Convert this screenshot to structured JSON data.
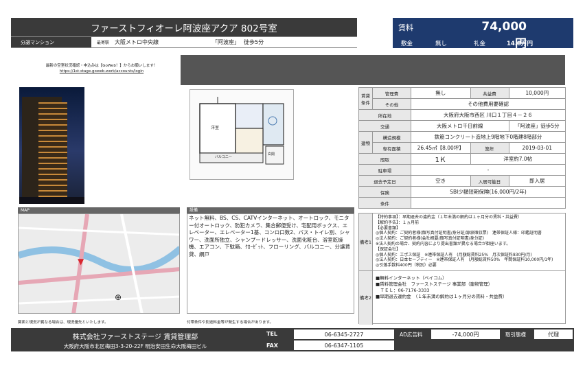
{
  "header": {
    "title": "ファーストフィオーレ阿波座アクア 802号室",
    "category": "分譲マンション",
    "station_label": "最寄駅",
    "line": "大阪メトロ中央線",
    "station": "「阿波座」",
    "walk": "徒歩5分"
  },
  "rent": {
    "label": "賃料",
    "value": "74,000円",
    "deposit_label": "敷金",
    "deposit": "無し",
    "key_label": "礼金",
    "key": "14.8万円"
  },
  "notice": {
    "line1": "最新の空室状況確認・申込みは【GoWeb！】からお願いします！",
    "url": "https://1st-stage.goweb.work/accounts/login"
  },
  "floorplan": {
    "balcony": "バルコニー",
    "room": "洋室",
    "entrance": "玄関"
  },
  "map": {
    "title": "MAP"
  },
  "settings": {
    "title": "設備",
    "text": "ネット無料、BS、CS、CATVインターネット、オートロック、モニター付オートロック、防犯カメラ、集合郵便受け、宅配用ボックス、エレベーター、エレベーター1基、コンロ口数2、バス・トイレ別、シャワー、洗面所独立、シャンプードレッサー、洗面化粧台、浴室乾燥機、エアコン、下駄箱、ｸﾛｰｾﾞｯﾄ、フローリング、バルコニー、分譲賃貸、網戸"
  },
  "footnotes": {
    "left": "図面と現況が異なる場合は、現況優先といたします。",
    "right": "付帯条件や別途料金等が発生する場合があります。"
  },
  "props": {
    "h_cond": "賃貸条件",
    "mgmt_label": "管理費",
    "mgmt": "無し",
    "common_label": "共益費",
    "common": "10,000円",
    "other_label": "その他",
    "other": "その他費用要確認",
    "loc_label": "所在地",
    "loc": "大阪府大阪市西区 川口１丁目４－２６",
    "traffic_label": "交通",
    "line": "大阪メトロ千日前線",
    "station": "「阿波座」徒歩5分",
    "h_bld": "建物",
    "struct_label": "構造規模",
    "struct": "鉄筋コンクリート造地上9階地下0階建8階部分",
    "area_label": "専有面積",
    "area": "26.45㎡【8.00坪】",
    "built_label": "築年",
    "built": "2019-03-01",
    "layout_label": "間取",
    "layout": "1Ｋ",
    "room": "洋室約7.0帖",
    "parking_label": "駐車場",
    "parking": "-",
    "vacate_label": "退去予定日",
    "vacate": "空き",
    "move_label": "入居可能日",
    "move": "即入居",
    "ins_label": "保険",
    "ins": "SBI少額短期保険(16,000円/2年)",
    "cond_label": "条件",
    "cond": ""
  },
  "remarks": {
    "h1": "備考1",
    "t1": "【特約事項】：早期退去の違約金（１年未満の解約は１ヶ月分の賃料・共益費）\n【解約予告】：１ヵ月前\n【必要書類】\n◎個人契約：ご契約者様(顔写真付証明書/身分証/源泉徴収票)　連帯保証人様：印鑑証明書\n◎法人契約：ご契約者様(会社概要/顔写真付証明書/身分証)\n※法人契約の場合、契約内容により提出書類が異なる場合が御座います。\n【保証会社】\n◎個人契約：エポス保証　※連帯保証人有　(月額総賃料25%　月次保証料830円/月)\n◎法人契約：日本セーフティー　※連帯保証人有　(月額総賃料50%　年間保証料10,000円/1年)\n◎引落手数料400円（税別）必要",
    "h2": "備考2",
    "t2": "■無料インターネット（ベイコム）\n■賃料管理会社　ファーストステージ 事業部（建物管理）\n　ＴＥＬ：06-7176-3333\n■早期退去違約金　（１年未満の解約は１ヶ月分の賃料・共益費）"
  },
  "footer": {
    "company": "株式会社ファーストステージ 賃貸管理部",
    "address": "大阪府大阪市北区梅田3-3-20-22F 明治安田生命大阪梅田ビル",
    "tel_label": "TEL",
    "tel": "06-6345-2727",
    "fax_label": "FAX",
    "fax": "06-6347-1105",
    "ad_label": "AD広告料",
    "ad": "-74,000円",
    "fee_label": "取引態様",
    "fee": "代理"
  }
}
